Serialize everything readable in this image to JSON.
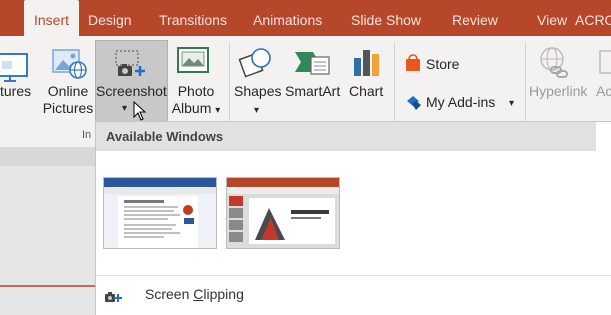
{
  "tabs": [
    {
      "label": "Insert",
      "active": true
    },
    {
      "label": "Design"
    },
    {
      "label": "Transitions"
    },
    {
      "label": "Animations"
    },
    {
      "label": "Slide Show"
    },
    {
      "label": "Review"
    },
    {
      "label": "View"
    },
    {
      "label": "ACRO"
    }
  ],
  "ribbon": {
    "pictures_partial_label": "tures",
    "online_pictures_label_1": "Online",
    "online_pictures_label_2": "Pictures",
    "screenshot_label": "Screenshot",
    "photo_album_label_1": "Photo",
    "photo_album_label_2": "Album",
    "photo_album_caret": "▾",
    "shapes_label": "Shapes",
    "shapes_caret": "▾",
    "smartart_label": "SmartArt",
    "chart_label": "Chart",
    "store_label": "Store",
    "my_addins_label": "My Add-ins",
    "my_addins_caret": "▾",
    "hyperlink_label": "Hyperlink",
    "action_partial_label": "Ac",
    "images_group_partial": "In"
  },
  "dropdown": {
    "title": "Available Windows",
    "windows": [
      {
        "icon": "word-document-window-thumbnail"
      },
      {
        "icon": "powerpoint-window-thumbnail"
      }
    ],
    "clip_prefix": "Screen ",
    "clip_underlined": "C",
    "clip_suffix": "lipping"
  },
  "colors": {
    "tab_bar": "#b7472a",
    "ribbon_bg": "#f3f2f1",
    "store_orange": "#e8581c",
    "addins_blue": "#1f6fc5"
  }
}
